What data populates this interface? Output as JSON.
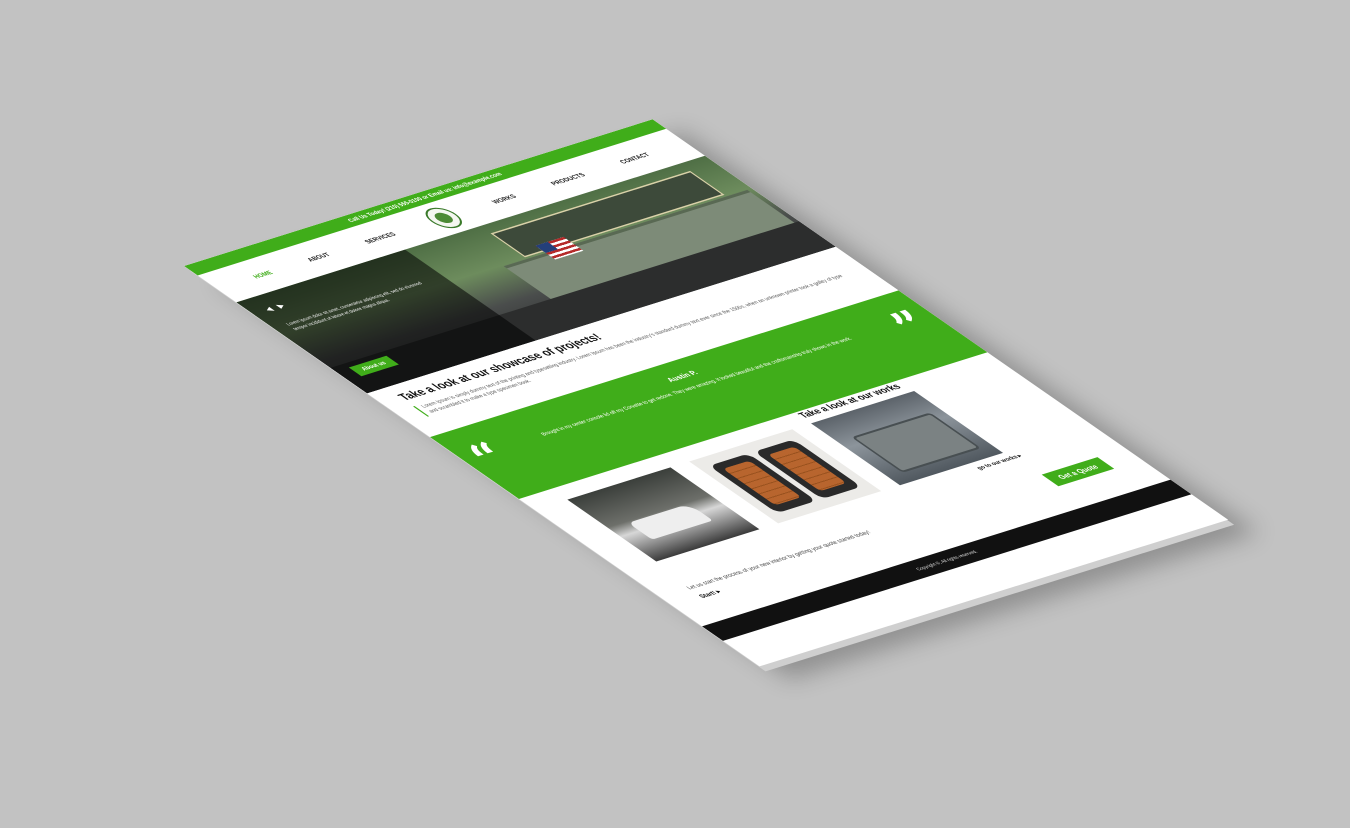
{
  "colors": {
    "accent": "#40ad1a",
    "background": "#c2c2c2",
    "footer": "#111111"
  },
  "topbar": {
    "text": "Call Us Today! (210) 555-0100 or Email us: info@example.com"
  },
  "nav": {
    "items": [
      {
        "label": "HOME"
      },
      {
        "label": "ABOUT"
      },
      {
        "label": "SERVICES"
      },
      {
        "label": "WORKS"
      },
      {
        "label": "PRODUCTS"
      },
      {
        "label": "CONTACT"
      }
    ],
    "logo_icon": "logo-emblem-icon"
  },
  "hero": {
    "arrow_prev": "◀",
    "arrow_next": "▶",
    "text": "Lorem ipsum dolor sit amet, consectetur adipiscing elit, sed do eiusmod tempor incididunt ut labore et dolore magna aliqua.",
    "button": "About us"
  },
  "showcase": {
    "title": "Take a look at our showcase of projects!",
    "text": "Lorem Ipsum is simply dummy text of the printing and typesetting industry. Lorem Ipsum has been the industry's standard dummy text ever since the 1500s, when an unknown printer took a galley of type and scrambled it to make a type specimen book."
  },
  "testimonial": {
    "quote_open": "“",
    "quote_close": "”",
    "name": "Austin P.",
    "text": "Brought in my center console lid off my Corvette to get redone. They were amazing. It looked beautiful and the craftsmanship truly shows in the work."
  },
  "works": {
    "title": "Take a look at our works",
    "link": "go to our works ▸"
  },
  "quote_section": {
    "text": "Let us start the process of your new interior by getting your quote started today!",
    "start": "Start! ▸",
    "button": "Get a Quote"
  },
  "footer": {
    "text": "Copyright ©, All rights reserved."
  }
}
